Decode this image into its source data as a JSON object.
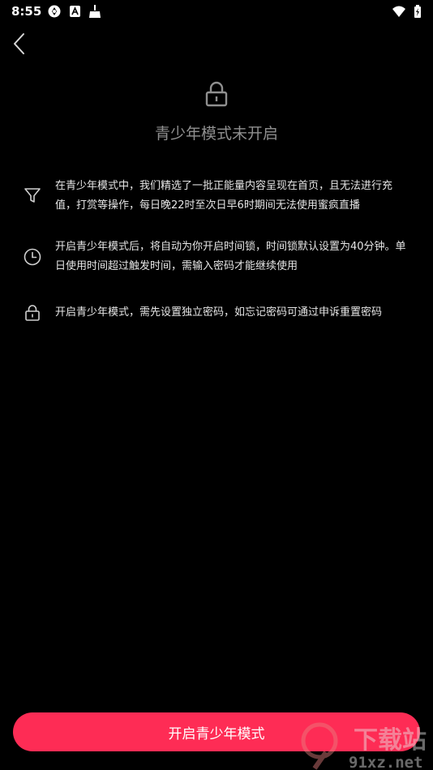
{
  "status_bar": {
    "time": "8:55"
  },
  "header": {
    "title": "青少年模式未开启"
  },
  "features": [
    {
      "icon": "filter-icon",
      "text": "在青少年模式中，我们精选了一批正能量内容呈现在首页，且无法进行充值，打赏等操作，每日晚22时至次日早6时期间无法使用蜜疯直播"
    },
    {
      "icon": "clock-icon",
      "text": "开启青少年模式后，将自动为你开启时间锁，时间锁默认设置为40分钟。单日使用时间超过触发时间，需输入密码才能继续使用"
    },
    {
      "icon": "lock-icon",
      "text": "开启青少年模式，需先设置独立密码，如忘记密码可通过申诉重置密码"
    }
  ],
  "cta": {
    "label": "开启青少年模式"
  },
  "watermark": {
    "text_top": "下载站",
    "text_bottom": "91xz.net"
  },
  "colors": {
    "background": "#000000",
    "accent": "#fe2c55",
    "title": "#8f8f8f",
    "text": "#e6e6e6"
  }
}
